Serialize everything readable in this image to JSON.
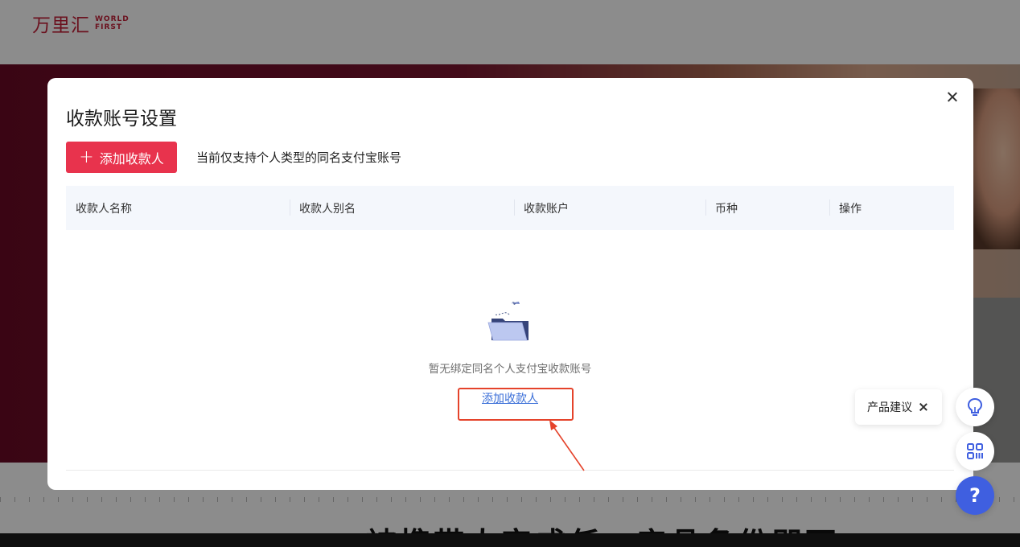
{
  "brand": {
    "name_cn": "万里汇",
    "name_en_line1": "WORLD",
    "name_en_line2": "FIRST",
    "color": "#c4223a"
  },
  "background": {
    "headline": "被携带人完成任一产品备份即可"
  },
  "modal": {
    "title": "收款账号设置",
    "add_button_label": "添加收款人",
    "tip": "当前仅支持个人类型的同名支付宝账号",
    "table": {
      "columns": [
        "收款人名称",
        "收款人别名",
        "收款账户",
        "币种",
        "操作"
      ]
    },
    "empty": {
      "message": "暂无绑定同名个人支付宝收款账号",
      "link_label": "添加收款人"
    }
  },
  "floating": {
    "suggestion_label": "产品建议",
    "help_label": "?"
  },
  "colors": {
    "accent": "#e8334d",
    "link": "#3b6fd8",
    "annotation": "#e5432b",
    "help_fab": "#3f5fe0"
  }
}
